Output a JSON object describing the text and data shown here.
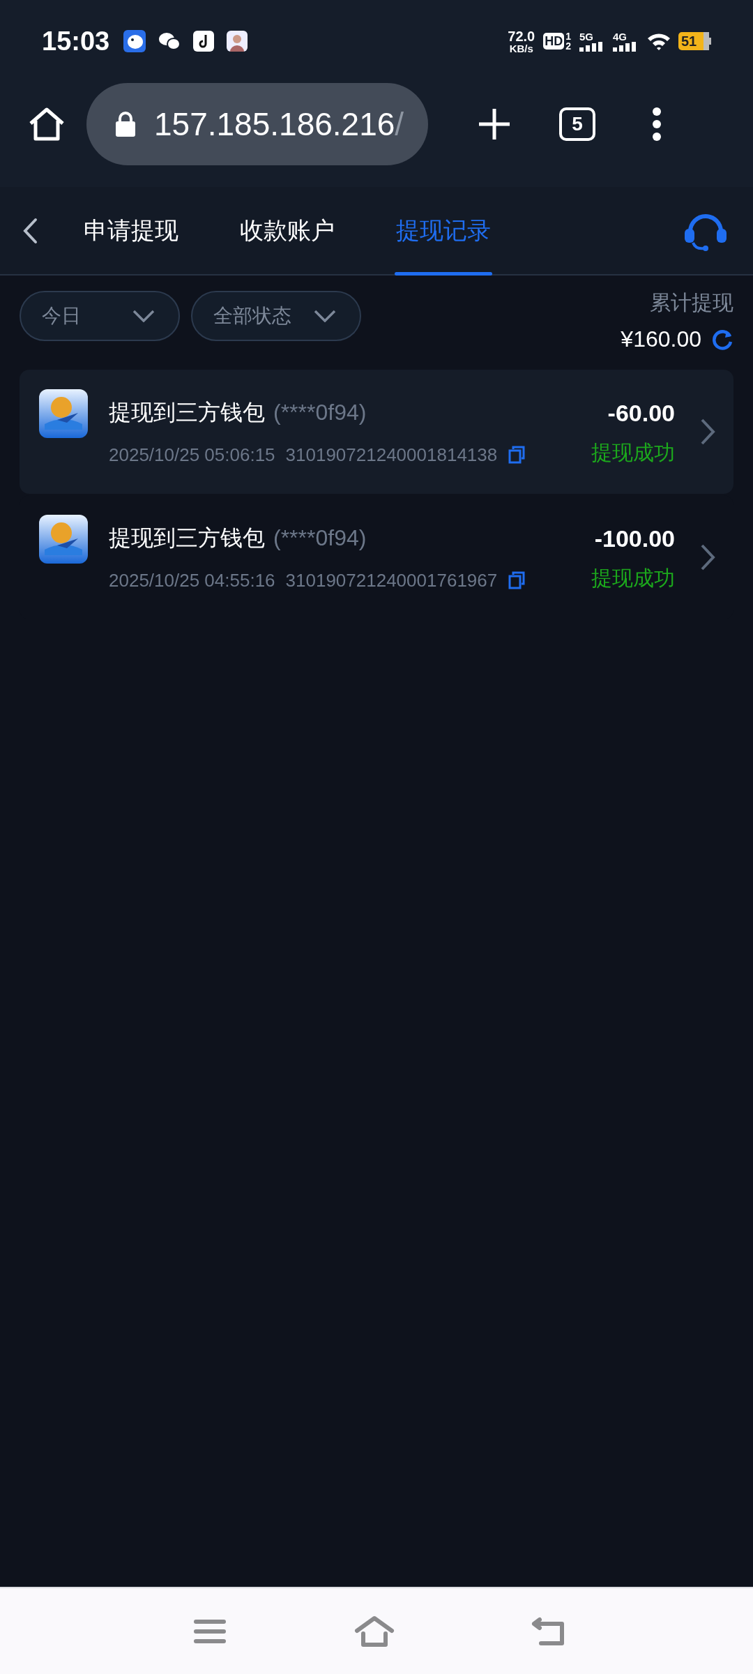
{
  "status_bar": {
    "time": "15:03",
    "net_speed": "72.0",
    "net_unit": "KB/s",
    "hd": "HD",
    "hd_sup": "1",
    "hd_sub": "2",
    "networks": [
      "5G",
      "4G"
    ],
    "battery": "51"
  },
  "browser": {
    "url_host": "157.185.186.216",
    "url_tail": "/",
    "tab_count": "5"
  },
  "tabs": [
    {
      "label": "申请提现",
      "selected": false
    },
    {
      "label": "收款账户",
      "selected": false
    },
    {
      "label": "提现记录",
      "selected": true
    }
  ],
  "filters": [
    {
      "label": "今日"
    },
    {
      "label": "全部状态"
    }
  ],
  "total": {
    "label": "累计提现",
    "amount": "¥160.00"
  },
  "records": [
    {
      "title": "提现到三方钱包",
      "account": "(****0f94)",
      "time": "2025/10/25 05:06:15",
      "order_no": "310190721240001814138",
      "amount": "-60.00",
      "status": "提现成功",
      "selected": true
    },
    {
      "title": "提现到三方钱包",
      "account": "(****0f94)",
      "time": "2025/10/25 04:55:16",
      "order_no": "310190721240001761967",
      "amount": "-100.00",
      "status": "提现成功",
      "selected": false
    }
  ]
}
